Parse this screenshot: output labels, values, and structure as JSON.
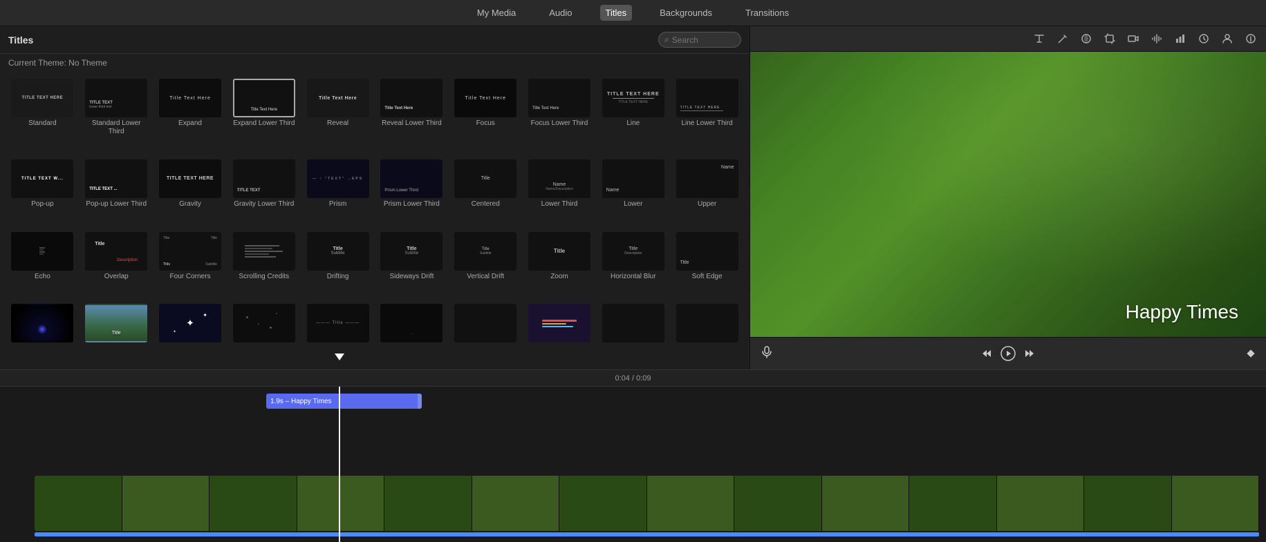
{
  "nav": {
    "items": [
      "My Media",
      "Audio",
      "Titles",
      "Backgrounds",
      "Transitions"
    ],
    "active": "Titles"
  },
  "panel": {
    "title": "Titles",
    "theme": "Current Theme: No Theme",
    "search_placeholder": "Search"
  },
  "toolbar": {
    "icons": [
      "T",
      "✎",
      "◉",
      "▣",
      "🎬",
      "🔊",
      "📊",
      "🔄",
      "👤",
      "ℹ"
    ]
  },
  "titles": [
    {
      "label": "Standard",
      "style": "standard"
    },
    {
      "label": "Standard Lower Third",
      "style": "standard-lower"
    },
    {
      "label": "Expand",
      "style": "expand"
    },
    {
      "label": "Expand Lower Third",
      "style": "expand-lower",
      "selected": true
    },
    {
      "label": "Reveal",
      "style": "reveal"
    },
    {
      "label": "Reveal Lower Third",
      "style": "reveal-lower"
    },
    {
      "label": "Focus",
      "style": "focus"
    },
    {
      "label": "Focus Lower Third",
      "style": "focus-lower"
    },
    {
      "label": "Line",
      "style": "line"
    },
    {
      "label": "Line Lower Third",
      "style": "line-lower"
    },
    {
      "label": "Pop-up",
      "style": "popup"
    },
    {
      "label": "Pop-up Lower Third",
      "style": "popup-lower"
    },
    {
      "label": "Gravity",
      "style": "gravity"
    },
    {
      "label": "Gravity Lower Third",
      "style": "gravity-lower"
    },
    {
      "label": "Prism",
      "style": "prism"
    },
    {
      "label": "Prism Lower Third",
      "style": "prism-lower"
    },
    {
      "label": "Centered",
      "style": "centered"
    },
    {
      "label": "Lower Third",
      "style": "lower-third"
    },
    {
      "label": "Lower",
      "style": "lower"
    },
    {
      "label": "Upper",
      "style": "upper"
    },
    {
      "label": "Echo",
      "style": "echo"
    },
    {
      "label": "Overlap",
      "style": "overlap"
    },
    {
      "label": "Four Corners",
      "style": "four-corners"
    },
    {
      "label": "Scrolling Credits",
      "style": "scrolling"
    },
    {
      "label": "Drifting",
      "style": "drifting"
    },
    {
      "label": "Sideways Drift",
      "style": "sideways"
    },
    {
      "label": "Vertical Drift",
      "style": "vertical-drift"
    },
    {
      "label": "Zoom",
      "style": "zoom"
    },
    {
      "label": "Horizontal Blur",
      "style": "horiz-blur"
    },
    {
      "label": "Soft Edge",
      "style": "soft-edge"
    },
    {
      "label": "",
      "style": "star-glow"
    },
    {
      "label": "",
      "style": "mountain"
    },
    {
      "label": "",
      "style": "sparkle-white"
    },
    {
      "label": "",
      "style": "black-sparkle"
    },
    {
      "label": "",
      "style": "title-overlay"
    },
    {
      "label": "",
      "style": "dark-lower"
    },
    {
      "label": "",
      "style": "more-items"
    },
    {
      "label": "",
      "style": "colorful-title"
    },
    {
      "label": "",
      "style": "extra1"
    },
    {
      "label": "",
      "style": "extra2"
    }
  ],
  "preview": {
    "title_text": "Happy Times",
    "time_current": "0:04",
    "time_total": "0:09",
    "time_separator": "/"
  },
  "timeline": {
    "title_clip_label": "1.9s – Happy Times",
    "playhead_time": "0:04"
  }
}
